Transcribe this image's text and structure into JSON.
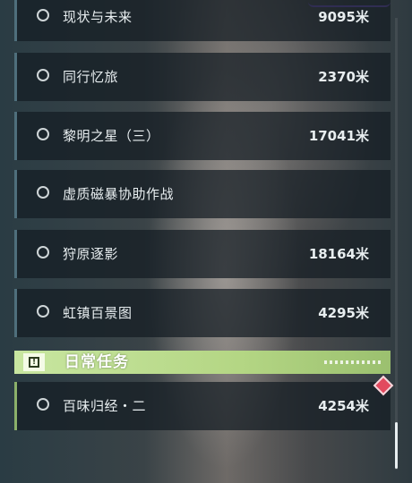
{
  "quests": [
    {
      "name": "现状与未来",
      "distance": "9095米"
    },
    {
      "name": "同行忆旅",
      "distance": "2370米"
    },
    {
      "name": "黎明之星（三）",
      "distance": "17041米"
    },
    {
      "name": "虚质磁暴协助作战",
      "distance": ""
    },
    {
      "name": "狩原逐影",
      "distance": "18164米"
    },
    {
      "name": "虹镇百景图",
      "distance": "4295米"
    }
  ],
  "daily_section": {
    "title": "日常任务",
    "icon": "exclamation-icon",
    "accent_color": "#b4d684"
  },
  "daily_quests": [
    {
      "name": "百味归经・二",
      "distance": "4254米"
    }
  ]
}
